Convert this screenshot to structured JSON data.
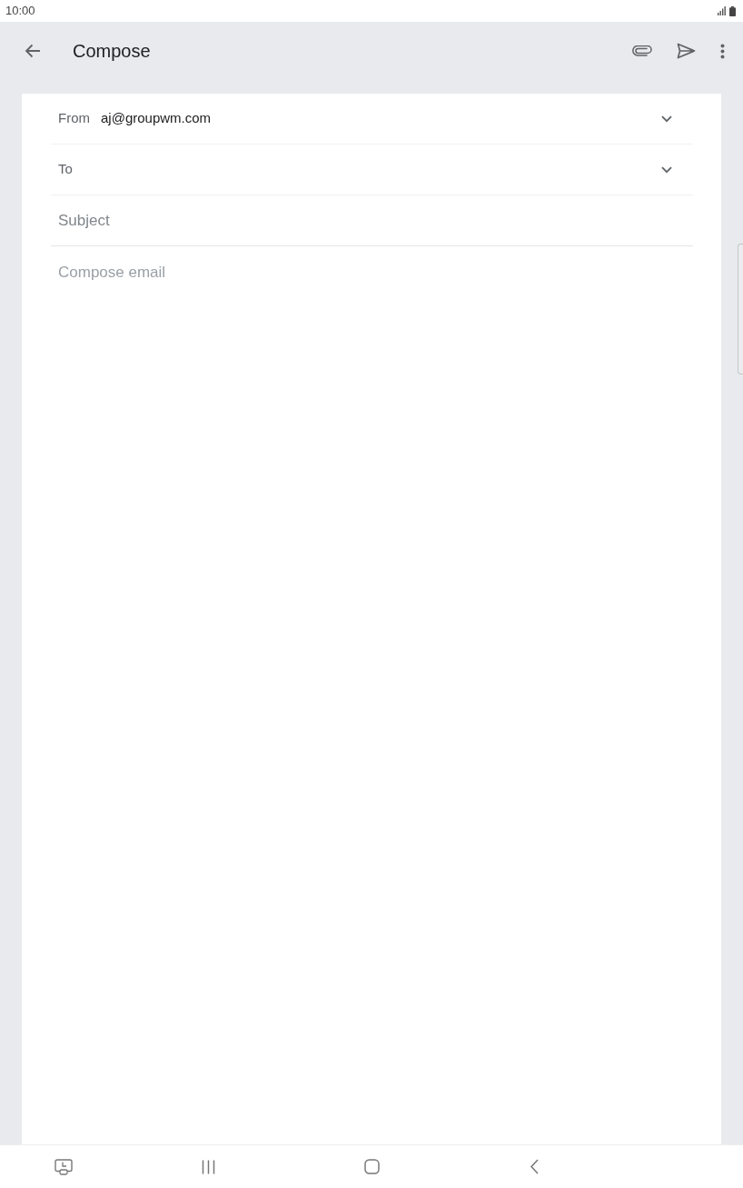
{
  "status_bar": {
    "time": "10:00"
  },
  "app_bar": {
    "title": "Compose"
  },
  "form": {
    "from": {
      "label": "From",
      "value": "aj@groupwm.com"
    },
    "to": {
      "label": "To"
    },
    "subject": {
      "placeholder": "Subject"
    },
    "body": {
      "placeholder": "Compose email"
    }
  }
}
